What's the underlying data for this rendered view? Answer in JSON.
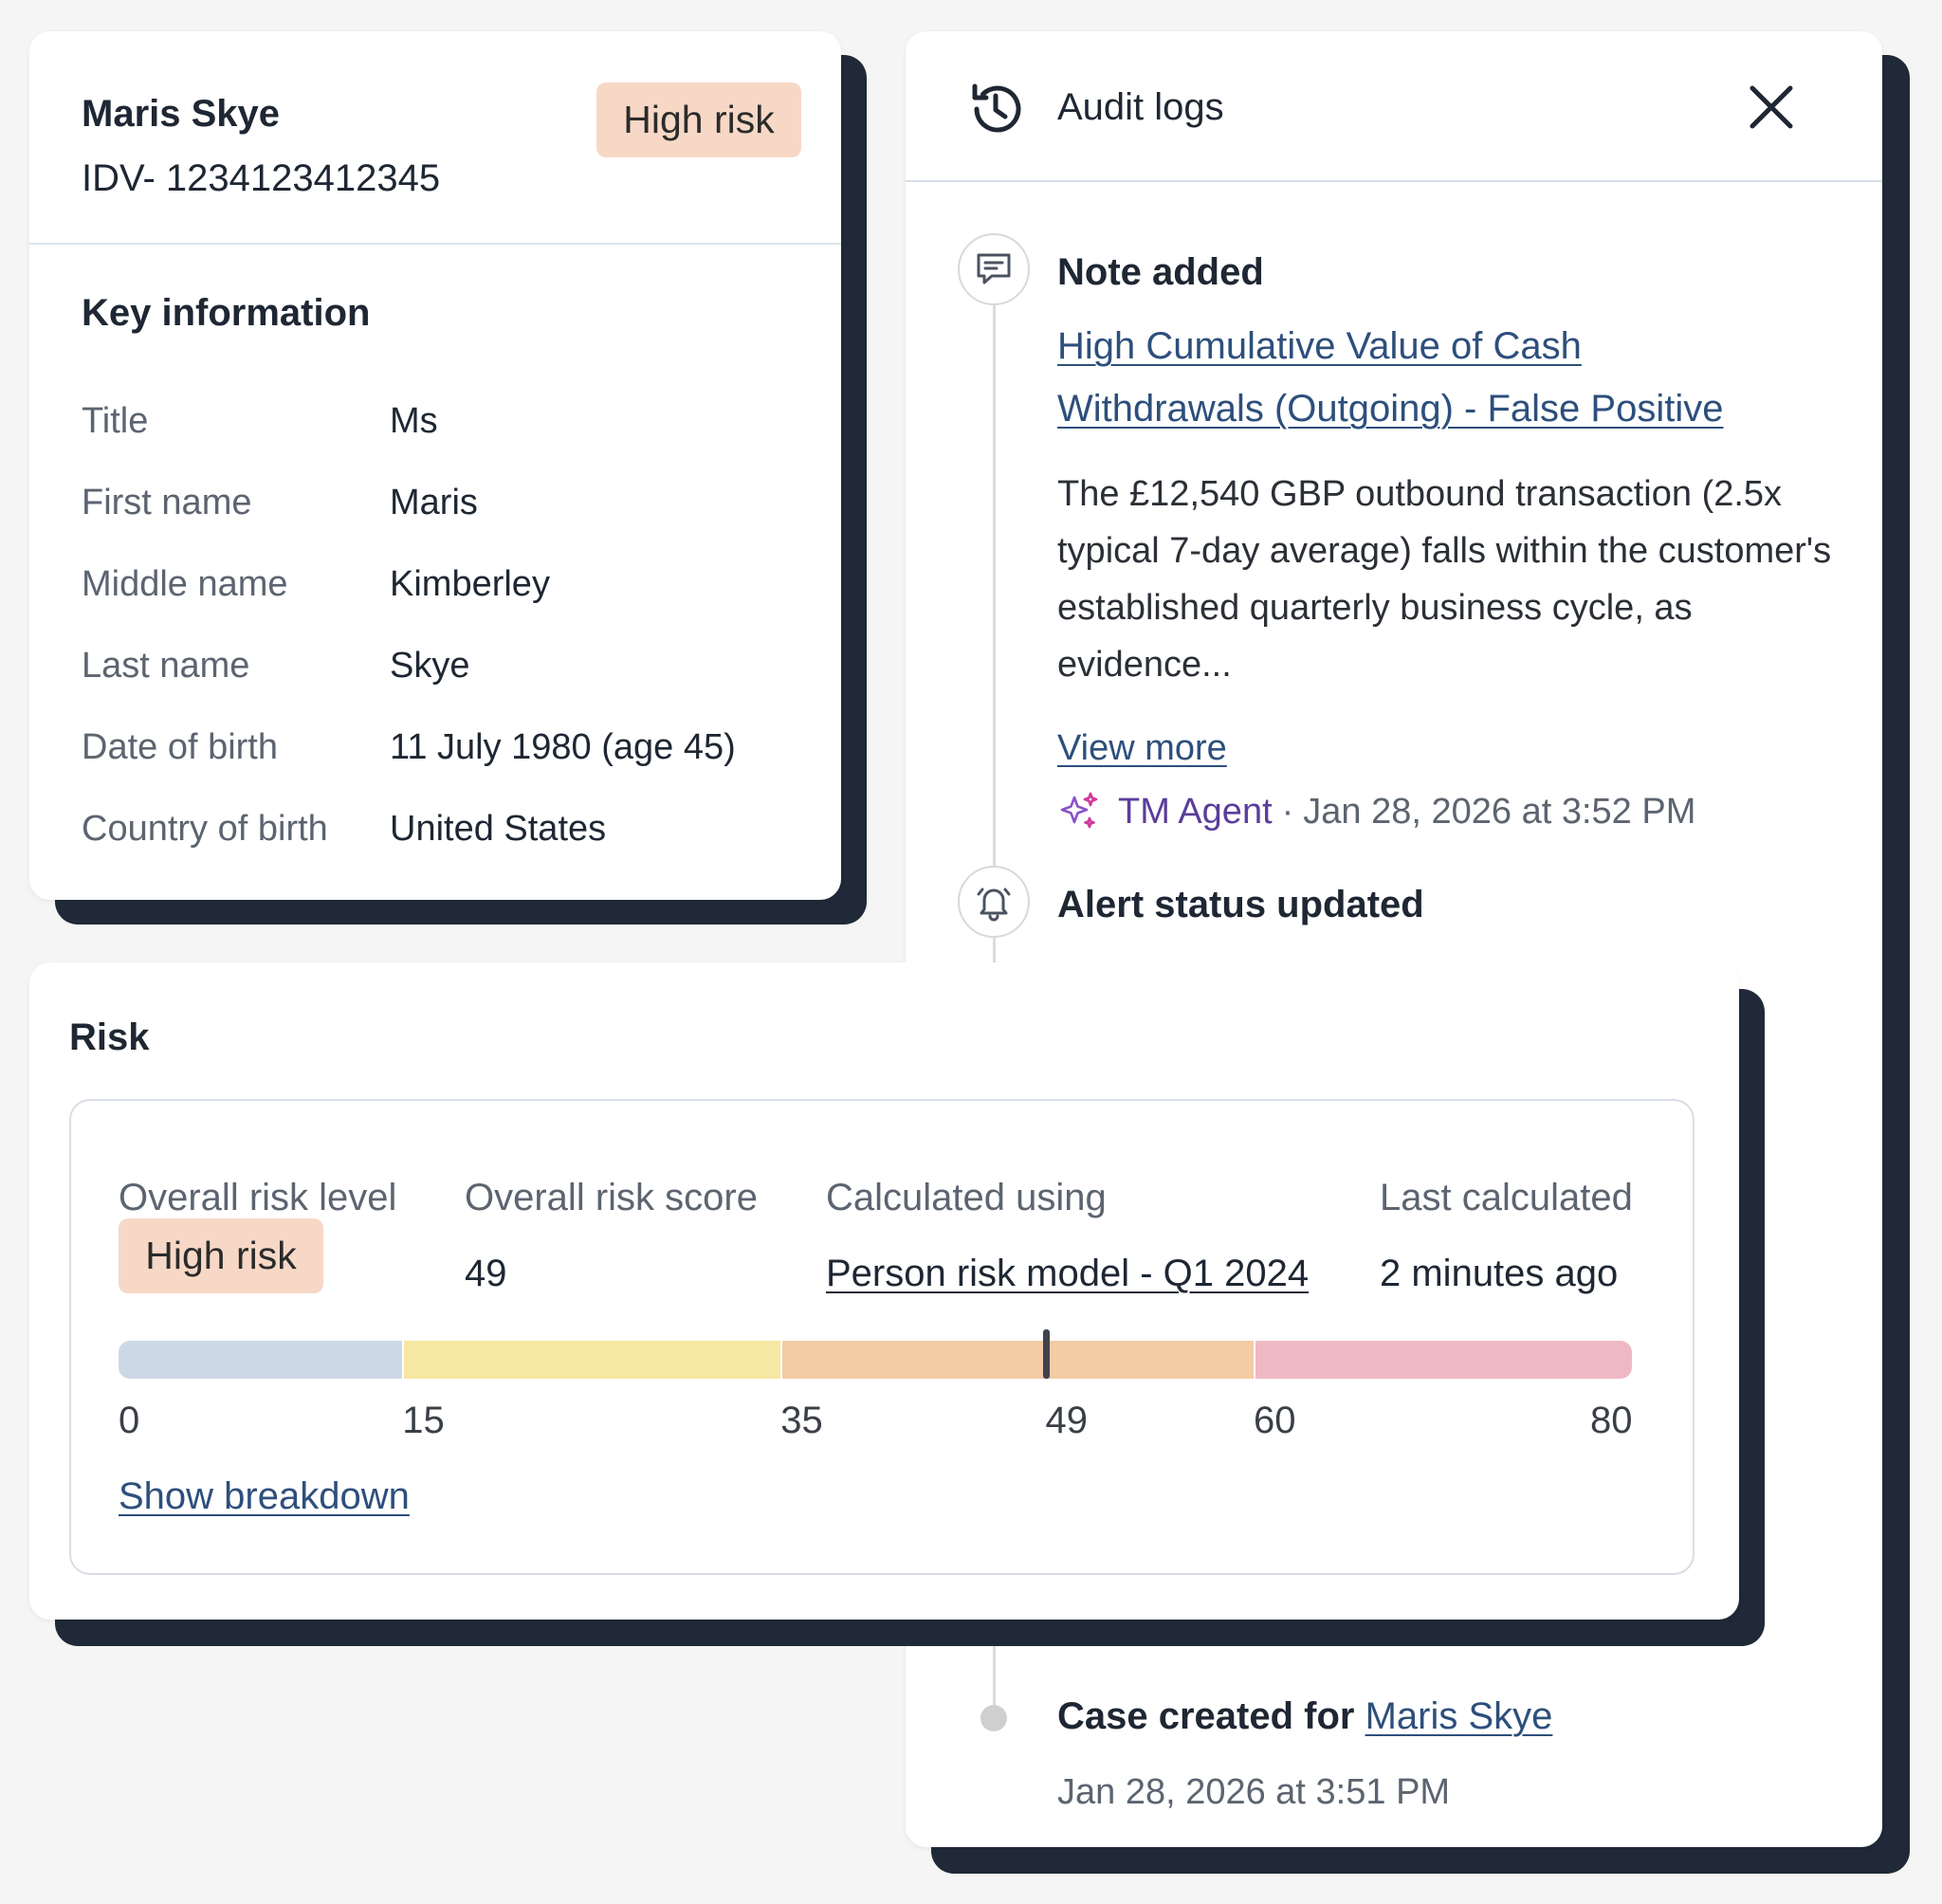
{
  "profile": {
    "name": "Maris Skye",
    "id": "IDV- 1234123412345",
    "risk_badge": "High risk",
    "section_title": "Key information",
    "fields": [
      {
        "label": "Title",
        "value": "Ms"
      },
      {
        "label": "First name",
        "value": "Maris"
      },
      {
        "label": "Middle name",
        "value": "Kimberley"
      },
      {
        "label": "Last name",
        "value": "Skye"
      },
      {
        "label": "Date of birth",
        "value": "11 July 1980 (age 45)"
      },
      {
        "label": "Country of birth",
        "value": "United States"
      }
    ]
  },
  "audit": {
    "title": "Audit logs",
    "icons": {
      "header": "history-icon",
      "close": "close-icon"
    },
    "events": [
      {
        "heading": "Note added",
        "icon": "comment-icon",
        "link_line1": "High Cumulative Value of Cash",
        "link_line2": "Withdrawals (Outgoing) - False Positive",
        "body": "The £12,540 GBP outbound transaction (2.5x typical 7-day average) falls within the customer's established quarterly business cycle, as evidence...",
        "view_more": "View more",
        "author": "TM Agent",
        "separator": "·",
        "timestamp": "Jan 28, 2026 at 3:52 PM"
      },
      {
        "heading": "Alert status updated",
        "icon": "bell-icon"
      },
      {
        "heading_prefix": "Case created for",
        "heading_link": "Maris Skye",
        "timestamp": "Jan 28, 2026 at 3:51 PM"
      }
    ]
  },
  "risk": {
    "title": "Risk",
    "columns": {
      "level_label": "Overall risk level",
      "level_value": "High risk",
      "score_label": "Overall risk score",
      "score_value": "49",
      "model_label": "Calculated using",
      "model_value": "Person risk model - Q1 2024",
      "last_label": "Last calculated",
      "last_value": "2 minutes ago"
    },
    "scale": {
      "min": 0,
      "max": 80,
      "score": 49,
      "ticks": [
        "0",
        "15",
        "35",
        "49",
        "60",
        "80"
      ],
      "segments": [
        {
          "from": 0,
          "to": 15,
          "color": "#cdd8e6"
        },
        {
          "from": 15,
          "to": 35,
          "color": "#f6e8a2"
        },
        {
          "from": 35,
          "to": 60,
          "color": "#f3cba5"
        },
        {
          "from": 60,
          "to": 80,
          "color": "#efb9c4"
        }
      ]
    },
    "breakdown_link": "Show breakdown"
  },
  "colors": {
    "badge": "#f7d8c6",
    "link": "#2d4f7c",
    "agent": "#5a3d9a",
    "shadow": "#1f2937"
  }
}
